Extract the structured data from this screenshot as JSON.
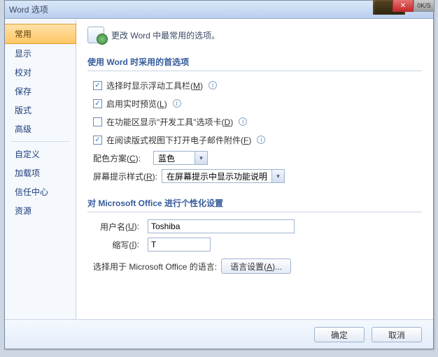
{
  "title": "Word 选项",
  "header": {
    "text": "更改 Word 中最常用的选项。"
  },
  "sidebar": {
    "items": [
      {
        "label": "常用",
        "selected": true
      },
      {
        "label": "显示"
      },
      {
        "label": "校对"
      },
      {
        "label": "保存"
      },
      {
        "label": "版式"
      },
      {
        "label": "高级"
      }
    ],
    "items2": [
      {
        "label": "自定义"
      },
      {
        "label": "加载项"
      },
      {
        "label": "信任中心"
      },
      {
        "label": "资源"
      }
    ]
  },
  "sections": {
    "top": {
      "title": "使用 Word 时采用的首选项",
      "opt1": {
        "checked": true,
        "label": "选择时显示浮动工具栏(",
        "hot": "M",
        "tail": ")"
      },
      "opt2": {
        "checked": true,
        "label": "启用实时预览(",
        "hot": "L",
        "tail": ")"
      },
      "opt3": {
        "checked": false,
        "label": "在功能区显示\"开发工具\"选项卡(",
        "hot": "D",
        "tail": ")"
      },
      "opt4": {
        "checked": true,
        "label": "在阅读版式视图下打开电子邮件附件(",
        "hot": "F",
        "tail": ")"
      },
      "colorLabel": "配色方案(",
      "colorHot": "C",
      "colorTail": "):",
      "colorValue": "蓝色",
      "tipLabel": "屏幕提示样式(",
      "tipHot": "R",
      "tipTail": "):",
      "tipValue": "在屏幕提示中显示功能说明"
    },
    "personal": {
      "title": "对 Microsoft Office 进行个性化设置",
      "userLabel": "用户名(",
      "userHot": "U",
      "userTail": "):",
      "userValue": "Toshiba",
      "initLabel": "缩写(",
      "initHot": "I",
      "initTail": "):",
      "initValue": "T",
      "langLine": "选择用于 Microsoft Office 的语言:",
      "langBtn": "语言设置(",
      "langHot": "A",
      "langTail": ")..."
    }
  },
  "footer": {
    "ok": "确定",
    "cancel": "取消"
  },
  "glyphs": {
    "check": "✓",
    "arrow": "▾",
    "info": "i",
    "close": "✕",
    "oks": "0K/S"
  }
}
